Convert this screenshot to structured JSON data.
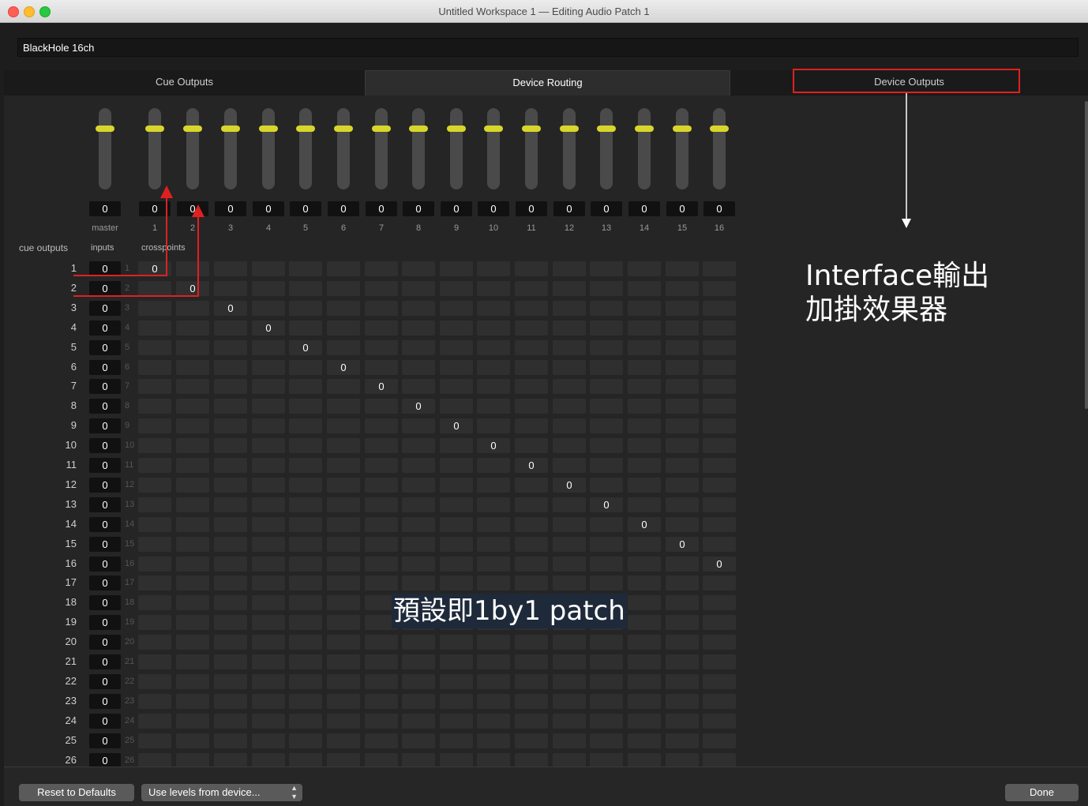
{
  "window": {
    "title": "Untitled Workspace 1 — Editing Audio Patch 1"
  },
  "device": {
    "name": "BlackHole 16ch"
  },
  "tabs": [
    {
      "label": "Cue Outputs"
    },
    {
      "label": "Device Routing"
    },
    {
      "label": "Device Outputs"
    }
  ],
  "headers": {
    "cue_outputs": "cue outputs",
    "inputs": "inputs",
    "crosspoints": "crosspoints"
  },
  "columns": {
    "labels": [
      "master",
      "1",
      "2",
      "3",
      "4",
      "5",
      "6",
      "7",
      "8",
      "9",
      "10",
      "11",
      "12",
      "13",
      "14",
      "15",
      "16"
    ],
    "levels": [
      "0",
      "0",
      "0",
      "0",
      "0",
      "0",
      "0",
      "0",
      "0",
      "0",
      "0",
      "0",
      "0",
      "0",
      "0",
      "0",
      "0"
    ]
  },
  "rows": {
    "numbers": [
      "1",
      "2",
      "3",
      "4",
      "5",
      "6",
      "7",
      "8",
      "9",
      "10",
      "11",
      "12",
      "13",
      "14",
      "15",
      "16",
      "17",
      "18",
      "19",
      "20",
      "21",
      "22",
      "23",
      "24",
      "25",
      "26"
    ],
    "input_levels": [
      "0",
      "0",
      "0",
      "0",
      "0",
      "0",
      "0",
      "0",
      "0",
      "0",
      "0",
      "0",
      "0",
      "0",
      "0",
      "0",
      "0",
      "0",
      "0",
      "0",
      "0",
      "0",
      "0",
      "0",
      "0",
      "0"
    ],
    "diagonal_value": "0"
  },
  "buttons": {
    "reset": "Reset to Defaults",
    "levels_select": "Use levels from device...",
    "done": "Done"
  },
  "annotations": {
    "right_line1": "Interface輸出",
    "right_line2": "加掛效果器",
    "center": "預設即1by1 patch"
  },
  "colors": {
    "highlight_red": "#e02020",
    "fader_handle": "#d9d62b"
  }
}
